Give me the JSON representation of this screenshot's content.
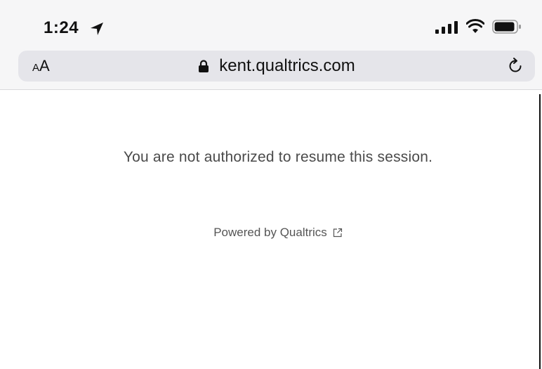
{
  "status_bar": {
    "time": "1:24"
  },
  "browser": {
    "text_size_small": "A",
    "text_size_large": "A",
    "url": "kent.qualtrics.com"
  },
  "page": {
    "message": "You are not authorized to resume this session.",
    "powered_by": "Powered by Qualtrics"
  },
  "icons": {
    "location": "location-arrow-icon",
    "signal": "cellular-signal-icon",
    "wifi": "wifi-icon",
    "battery": "battery-icon",
    "lock": "lock-icon",
    "reload": "reload-icon",
    "external": "external-link-icon"
  }
}
